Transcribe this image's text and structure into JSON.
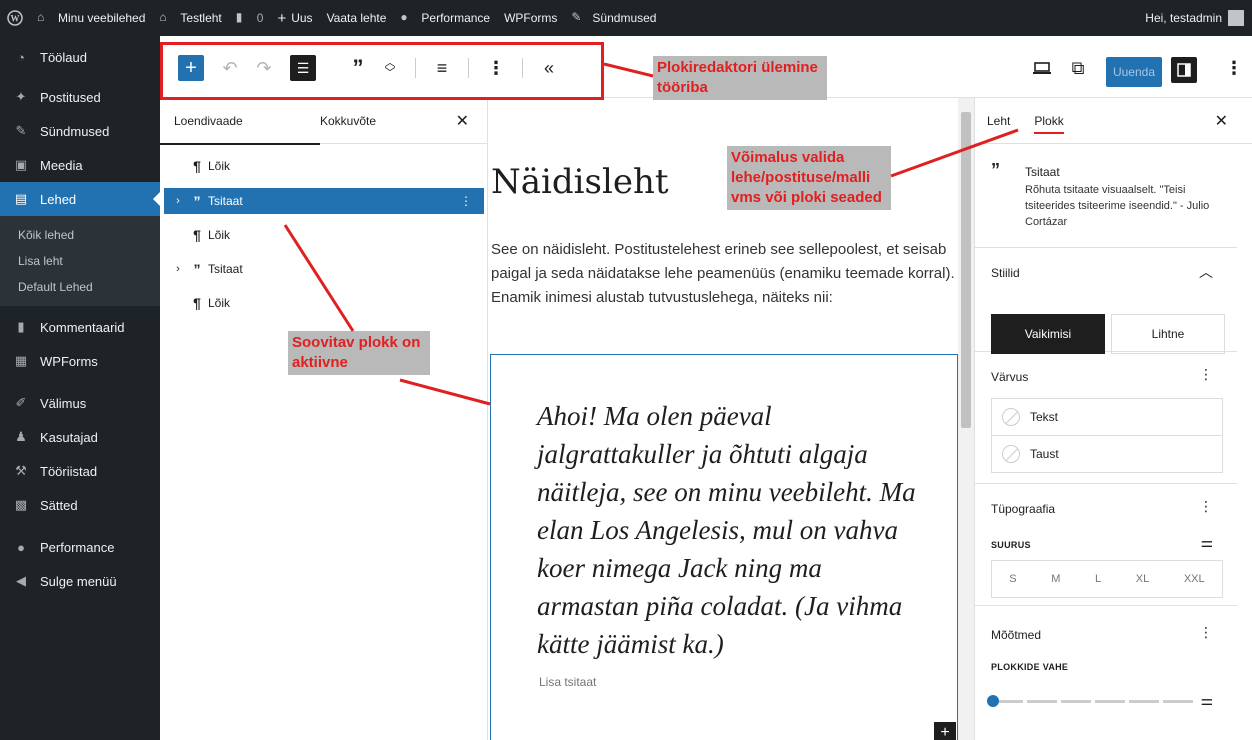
{
  "admin_bar": {
    "site_name": "Minu veebilehed",
    "page_name": "Testleht",
    "comments_count": "0",
    "new_label": "Uus",
    "view_label": "Vaata lehte",
    "performance_label": "Performance",
    "wpforms_label": "WPForms",
    "events_label": "Sündmused",
    "greeting": "Hei, testadmin"
  },
  "sidebar": {
    "items": [
      {
        "label": "Töölaud",
        "icon": "dashboard-icon"
      },
      {
        "label": "Postitused",
        "icon": "pin-icon"
      },
      {
        "label": "Sündmused",
        "icon": "events-icon"
      },
      {
        "label": "Meedia",
        "icon": "media-icon"
      },
      {
        "label": "Lehed",
        "icon": "page-icon"
      },
      {
        "label": "Kommentaarid",
        "icon": "comment-icon"
      },
      {
        "label": "WPForms",
        "icon": "forms-icon"
      },
      {
        "label": "Välimus",
        "icon": "brush-icon"
      },
      {
        "label": "Kasutajad",
        "icon": "users-icon"
      },
      {
        "label": "Tööriistad",
        "icon": "wrench-icon"
      },
      {
        "label": "Sätted",
        "icon": "settings-icon"
      },
      {
        "label": "Performance",
        "icon": "performance-icon"
      },
      {
        "label": "Sulge menüü",
        "icon": "collapse-icon"
      }
    ],
    "submenu": [
      "Kõik lehed",
      "Lisa leht",
      "Default Lehed"
    ]
  },
  "toolbar": {
    "update_label": "Uuenda"
  },
  "annotations": {
    "toolbar_label": "Plokiredaktori ülemine tööriba",
    "settings_label": "Võimalus valida lehe/postituse/malli vms või ploki seaded",
    "active_label": "Soovitav plokk on aktiivne"
  },
  "list_view": {
    "tab_list": "Loendivaade",
    "tab_outline": "Kokkuvõte",
    "rows": [
      {
        "label": "Lõik",
        "type": "paragraph"
      },
      {
        "label": "Tsitaat",
        "type": "quote"
      },
      {
        "label": "Lõik",
        "type": "paragraph"
      },
      {
        "label": "Tsitaat",
        "type": "quote"
      },
      {
        "label": "Lõik",
        "type": "paragraph"
      }
    ]
  },
  "canvas": {
    "title": "Näidisleht",
    "paragraph": "See on näidisleht. Postitustelehest erineb see sellepoolest, et seisab paigal ja seda näidatakse lehe peamenüüs (enamiku teemade korral). Enamik inimesi alustab tutvustuslehega, näiteks nii:",
    "quote": "Ahoi! Ma olen päeval jalgrattakuller ja õhtuti algaja näitleja, see on minu veebileht. Ma elan Los Angelesis, mul on vahva koer nimega Jack ning ma armastan piña coladat. (Ja vihma kätte jäämist ka.)",
    "citation_placeholder": "Lisa tsitaat"
  },
  "settings": {
    "tab_page": "Leht",
    "tab_block": "Plokk",
    "block_name": "Tsitaat",
    "block_desc": "Rõhuta tsitaate visuaalselt. \"Teisi tsiteerides tsiteerime iseendid.\" - Julio Cortázar",
    "styles_title": "Stiilid",
    "style_default": "Vaikimisi",
    "style_plain": "Lihtne",
    "color_title": "Värvus",
    "color_text": "Tekst",
    "color_bg": "Taust",
    "typo_title": "Tüpograafia",
    "size_label": "SUURUS",
    "sizes": [
      "S",
      "M",
      "L",
      "XL",
      "XXL"
    ],
    "dims_title": "Mõõtmed",
    "gap_label": "PLOKKIDE VAHE"
  }
}
